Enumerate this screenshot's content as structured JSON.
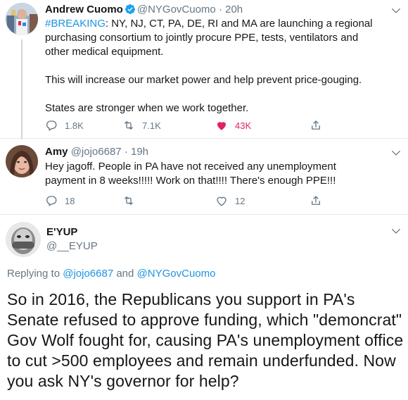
{
  "tweet1": {
    "name": "Andrew Cuomo",
    "handle": "@NYGovCuomo",
    "dot": "·",
    "time": "20h",
    "hashtag": "#BREAKING",
    "line1_rest": ": NY, NJ, CT, PA, DE, RI and MA are launching a regional purchasing consortium to jointly procure PPE, tests, ventilators and other medical equipment.",
    "para2": "This will increase our market power and help prevent price-gouging.",
    "para3": "States are stronger when we work together.",
    "replies": "1.8K",
    "retweets": "7.1K",
    "likes": "43K",
    "like_color": "#e0245e"
  },
  "tweet2": {
    "name": "Amy",
    "handle": "@jojo6687",
    "dot": "·",
    "time": "19h",
    "text": "Hey jagoff. People in PA have not received any unemployment payment in 8 weeks!!!!! Work on that!!!! There's enough PPE!!!",
    "replies": "18",
    "retweets": "",
    "likes": "12"
  },
  "tweet3": {
    "name": "E'YUP",
    "handle": "@__EYUP",
    "replying_prefix": "Replying to ",
    "replying_user1": "@jojo6687",
    "replying_and": " and ",
    "replying_user2": "@NYGovCuomo",
    "text": "So in 2016, the Republicans you support in PA's Senate refused to approve funding, which \"demoncrat\" Gov Wolf fought for, causing PA's unemployment office to cut >500 employees and remain underfunded. Now you ask NY's governor for help?"
  },
  "colors": {
    "link": "#1b95e0",
    "muted": "#657786",
    "text": "#14171a"
  }
}
